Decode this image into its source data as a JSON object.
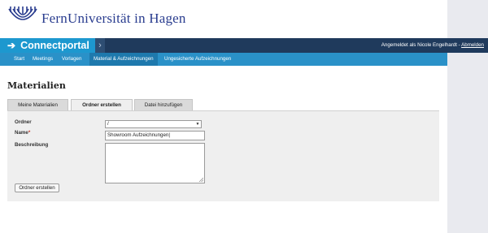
{
  "brand": {
    "name": "FernUniversität in Hagen",
    "logo_icon": "fernuni-logo-icon"
  },
  "header": {
    "app_title": "Connectportal",
    "user_text": "Angemeldet als Nicole Engelhardt - ",
    "logout_label": "Abmelden"
  },
  "nav": {
    "items": [
      {
        "label": "Start"
      },
      {
        "label": "Meetings"
      },
      {
        "label": "Vorlagen"
      },
      {
        "label": "Material & Aufzeichnungen"
      },
      {
        "label": "Ungesicherte Aufzeichnungen"
      }
    ],
    "active_index": 3
  },
  "main": {
    "title": "Materialien",
    "tabs": [
      {
        "label": "Meine Materialien"
      },
      {
        "label": "Ordner erstellen"
      },
      {
        "label": "Datei hinzufügen"
      }
    ],
    "active_tab_index": 1
  },
  "form": {
    "folder_label": "Ordner",
    "folder_value": "/",
    "name_label": "Name",
    "name_required_marker": "*",
    "name_value": "Showroom Aufzeichnungen|",
    "description_label": "Beschreibung",
    "description_value": "",
    "submit_label": "Ordner erstellen"
  },
  "colors": {
    "title_bar": "#1f3a5c",
    "accent": "#1d98cf",
    "nav_bar": "#2a91c8",
    "nav_active": "#1e79ad",
    "brand_text": "#2a3d8f"
  }
}
